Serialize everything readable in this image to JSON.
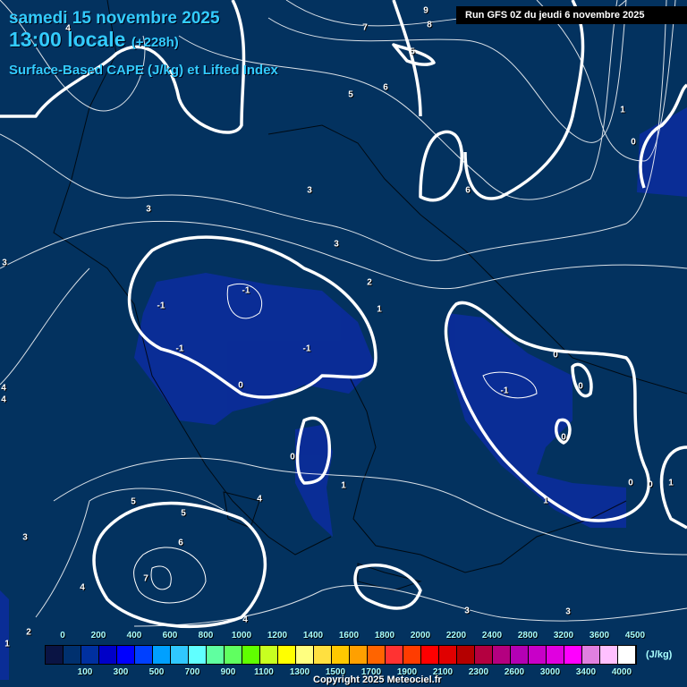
{
  "header": {
    "date": "samedi 15 novembre 2025",
    "time": "13:00 locale",
    "lead": "(+228h)",
    "product": "Surface-Based CAPE (J/kg) et Lifted Index",
    "run": "Run GFS 0Z du jeudi 6 novembre 2025"
  },
  "contour_labels": [
    "9",
    "8",
    "7",
    "5",
    "6",
    "5",
    "4",
    "3",
    "3",
    "3",
    "3",
    "2",
    "1",
    "-1",
    "-1",
    "-1",
    "-1",
    "0",
    "-1",
    "0",
    "0",
    "0",
    "0",
    "0",
    "1",
    "1",
    "0",
    "5",
    "5",
    "4",
    "6",
    "7",
    "3",
    "4",
    "4",
    "4",
    "4",
    "3",
    "3",
    "1",
    "2",
    "1",
    "6",
    "1",
    "0"
  ],
  "legend": {
    "unit": "(J/kg)",
    "colors": [
      "#0a1444",
      "#00306e",
      "#0030a0",
      "#0000c8",
      "#0000ff",
      "#0040ff",
      "#00a0ff",
      "#30c8ff",
      "#60ffff",
      "#60ffa0",
      "#60ff60",
      "#60ff00",
      "#c8ff20",
      "#ffff00",
      "#ffff80",
      "#ffe040",
      "#ffc800",
      "#ffa000",
      "#ff6400",
      "#ff3232",
      "#ff3c00",
      "#ff0000",
      "#e00000",
      "#b40000",
      "#b40040",
      "#b40080",
      "#b400b4",
      "#c800c8",
      "#e000e0",
      "#ff00ff",
      "#e080e0",
      "#ffc0ff",
      "#ffffff"
    ],
    "top_labels": [
      "0",
      "200",
      "400",
      "600",
      "800",
      "1000",
      "1200",
      "1400",
      "1600",
      "1800",
      "2000",
      "2200",
      "2400",
      "2800",
      "3200",
      "3600",
      "4500"
    ],
    "bottom_labels": [
      "100",
      "300",
      "500",
      "700",
      "900",
      "1100",
      "1300",
      "1500",
      "1700",
      "1900",
      "2100",
      "2300",
      "2600",
      "3000",
      "3400",
      "4000"
    ]
  },
  "copyright": "Copyright 2025 Meteociel.fr",
  "colors": {
    "background": "#03325f",
    "cape_low": "#0a2a9a",
    "title": "#33ccff"
  }
}
